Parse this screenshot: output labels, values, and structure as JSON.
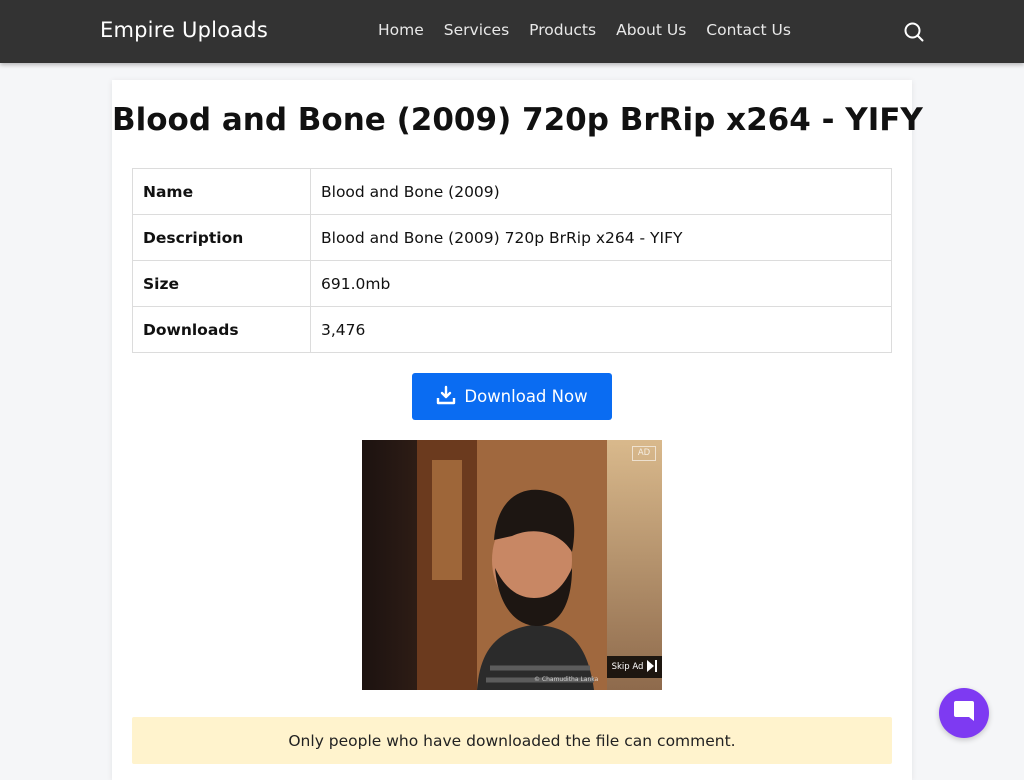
{
  "header": {
    "brand": "Empire Uploads",
    "nav": [
      "Home",
      "Services",
      "Products",
      "About Us",
      "Contact Us"
    ],
    "search_icon": "search-icon"
  },
  "file": {
    "title": "Blood and Bone (2009) 720p BrRip x264 - YIFY",
    "details": [
      {
        "label": "Name",
        "value": "Blood and Bone (2009)"
      },
      {
        "label": "Description",
        "value": "Blood and Bone (2009) 720p BrRip x264 - YIFY"
      },
      {
        "label": "Size",
        "value": "691.0mb"
      },
      {
        "label": "Downloads",
        "value": "3,476"
      }
    ],
    "download_label": "Download Now",
    "download_icon": "download-icon"
  },
  "ad": {
    "badge": "AD",
    "skip_label": "Skip Ad",
    "credit": "© Chamuditha Lanka"
  },
  "notice": "Only people who have downloaded the file can comment.",
  "chat_icon": "chat-bubble-icon",
  "colors": {
    "navbar": "#333333",
    "primary": "#0a6cf2",
    "notice_bg": "#fff3cd",
    "chat_button": "#7e3af2"
  }
}
